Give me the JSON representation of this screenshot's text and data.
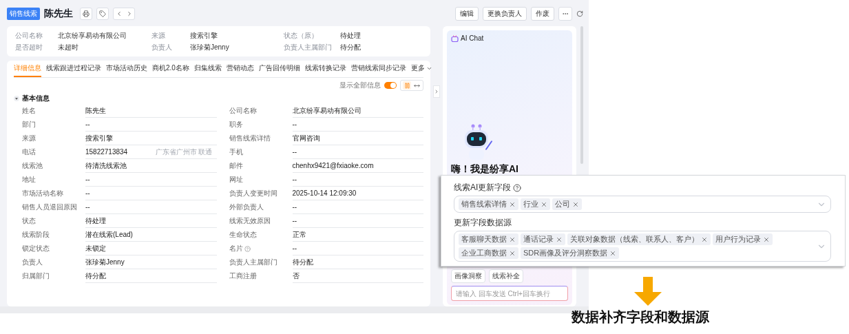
{
  "header": {
    "tag": "销售线索",
    "title": "陈先生",
    "actions": [
      "编辑",
      "更换负责人",
      "作废"
    ]
  },
  "summary": [
    {
      "label": "公司名称",
      "value": "北京纷享易动有限公司"
    },
    {
      "label": "来源",
      "value": "搜索引擎"
    },
    {
      "label": "状态（原）",
      "value": "待处理"
    },
    {
      "label": "是否超时",
      "value": "未超时"
    },
    {
      "label": "负责人",
      "value": "张珍菊Jenny"
    },
    {
      "label": "负责人主属部门",
      "value": "待分配"
    }
  ],
  "tabs": [
    {
      "label": "详细信息",
      "selected": true
    },
    {
      "label": "线索跟进过程记录",
      "selected": false
    },
    {
      "label": "市场活动历史",
      "selected": false
    },
    {
      "label": "商机2.0名称",
      "selected": false
    },
    {
      "label": "归集线索",
      "selected": false
    },
    {
      "label": "营销动态",
      "selected": false
    },
    {
      "label": "广告回传明细",
      "selected": false
    },
    {
      "label": "线索转换记录",
      "selected": false
    },
    {
      "label": "营销线索同步记录",
      "selected": false
    },
    {
      "label": "更多",
      "selected": false
    }
  ],
  "toolbar": {
    "show_all_label": "显示全部信息",
    "show_all_on": true,
    "layout_modes": [
      {
        "kind": "columns",
        "selected": true
      },
      {
        "kind": "stretch",
        "selected": false
      }
    ]
  },
  "section": {
    "title": "基本信息",
    "expanded": true,
    "fields": [
      {
        "label": "姓名",
        "value": "陈先生"
      },
      {
        "label": "公司名称",
        "value": "北京纷享易动有限公司"
      },
      {
        "label": "部门",
        "value": "--"
      },
      {
        "label": "职务",
        "value": "--"
      },
      {
        "label": "来源",
        "value": "搜索引擎"
      },
      {
        "label": "销售线索详情",
        "value": "官网咨询"
      },
      {
        "label": "电话",
        "value": "15822713834",
        "hint": "广东省广州市 联通"
      },
      {
        "label": "手机",
        "value": "--"
      },
      {
        "label": "线索池",
        "value": "待清洗线索池"
      },
      {
        "label": "邮件",
        "value": "chenhx9421@fxiaoke.com"
      },
      {
        "label": "地址",
        "value": "--"
      },
      {
        "label": "网址",
        "value": "--"
      },
      {
        "label": "市场活动名称",
        "value": "--"
      },
      {
        "label": "负责人变更时间",
        "value": "2025-10-14 12:09:30"
      },
      {
        "label": "销售人员退回原因",
        "value": "--"
      },
      {
        "label": "外部负责人",
        "value": "--"
      },
      {
        "label": "状态",
        "value": "待处理"
      },
      {
        "label": "线索无效原因",
        "value": "--"
      },
      {
        "label": "线索阶段",
        "value": "潜在线索(Lead)"
      },
      {
        "label": "生命状态",
        "value": "正常"
      },
      {
        "label": "锁定状态",
        "value": "未锁定"
      },
      {
        "label": "名片",
        "value": "--",
        "help": true
      },
      {
        "label": "负责人",
        "value": "张珍菊Jenny"
      },
      {
        "label": "负责人主属部门",
        "value": "待分配"
      },
      {
        "label": "归属部门",
        "value": "待分配"
      },
      {
        "label": "工商注册",
        "value": "否"
      }
    ]
  },
  "ai_chat": {
    "title": "AI Chat",
    "greeting": "嗨！我是纷享AI",
    "chips": [
      "画像洞察",
      "线索补全"
    ],
    "input_placeholder": "请输入 回车发送 Ctrl+回车换行"
  },
  "overlay": {
    "groups": [
      {
        "label": "线索AI更新字段",
        "help": true,
        "tags": [
          "销售线索详情",
          "行业",
          "公司"
        ]
      },
      {
        "label": "更新字段数据源",
        "help": false,
        "tags": [
          "客服聊天数据",
          "通话记录",
          "关联对象数据（线索、联系人、客户）",
          "用户行为记录",
          "企业工商数据",
          "SDR画像及评分洞察数据"
        ]
      }
    ]
  },
  "caption": "数据补齐字段和数据源"
}
